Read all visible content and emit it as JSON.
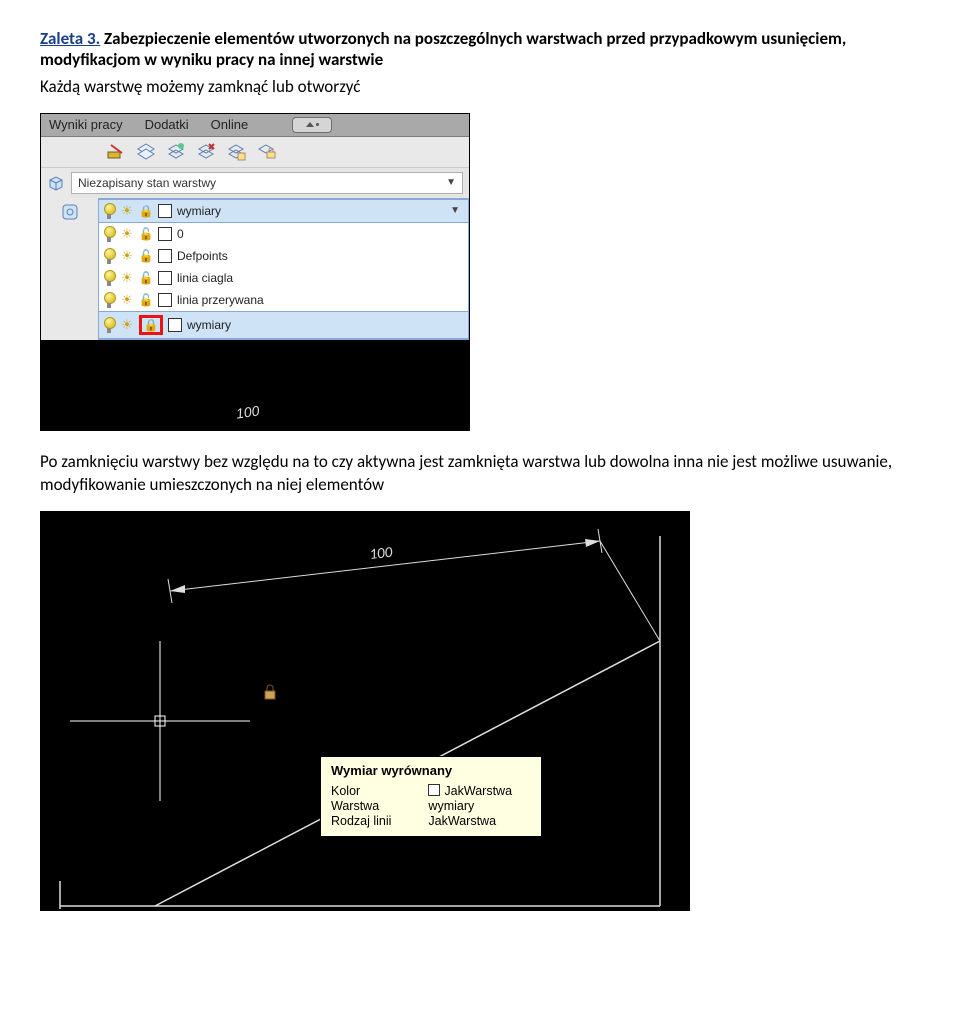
{
  "title": {
    "label": "Zaleta 3.",
    "rest": " Zabezpieczenie elementów utworzonych na poszczególnych warstwach przed przypadkowym usunięciem, modyfikacjom w wyniku pracy na innej warstwie"
  },
  "para1": "Każdą warstwę możemy zamknąć lub otworzyć",
  "menubar": {
    "items": [
      "Wyniki pracy",
      "Dodatki",
      "Online"
    ]
  },
  "layer_state_label": "Niezapisany stan warstwy",
  "layers": [
    {
      "name": "wymiary",
      "locked": true,
      "selected": true
    },
    {
      "name": "0",
      "locked": false
    },
    {
      "name": "Defpoints",
      "locked": false
    },
    {
      "name": "linia ciagla",
      "locked": false
    },
    {
      "name": "linia przerywana",
      "locked": false
    },
    {
      "name": "wymiary",
      "locked": true,
      "selected": true,
      "redbox": true
    }
  ],
  "dim_label": "100",
  "para2": "Po zamknięciu warstwy bez względu na to czy aktywna jest zamknięta warstwa lub dowolna inna nie jest możliwe usuwanie, modyfikowanie umieszczonych na niej elementów",
  "shot2": {
    "dim_label": "100",
    "tooltip": {
      "title": "Wymiar wyrównany",
      "rows": [
        {
          "k": "Kolor",
          "v": "JakWarstwa",
          "sw": true
        },
        {
          "k": "Warstwa",
          "v": "wymiary"
        },
        {
          "k": "Rodzaj linii",
          "v": "JakWarstwa"
        }
      ]
    }
  }
}
